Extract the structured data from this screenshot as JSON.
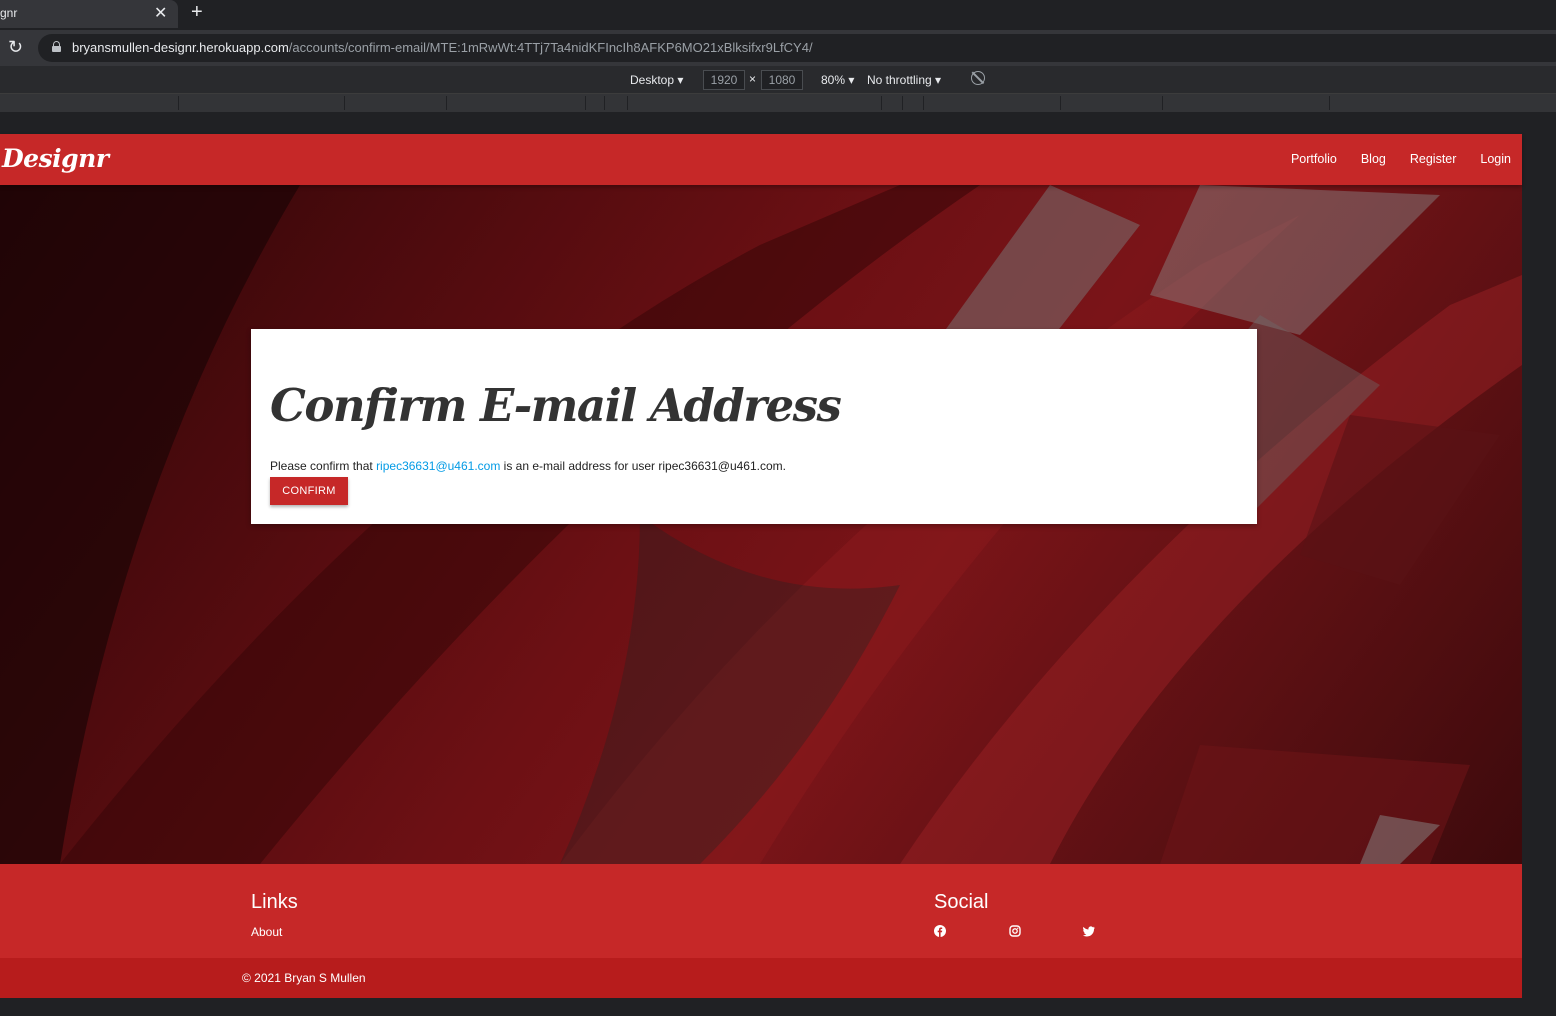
{
  "browser": {
    "tab_title": "gnr",
    "tab_close": "✕",
    "new_tab": "+",
    "reload": "↻",
    "url_host": "bryansmullen-designr.herokuapp.com",
    "url_path": "/accounts/confirm-email/MTE:1mRwWt:4TTj7Ta4nidKFIncIh8AFKP6MO21xBlksifxr9LfCY4/"
  },
  "devtools": {
    "device": "Desktop ▾",
    "width": "1920",
    "times": "×",
    "height": "1080",
    "zoom": "80% ▾",
    "throttling": "No throttling ▾"
  },
  "navbar": {
    "brand": "Designr",
    "links": [
      "Portfolio",
      "Blog",
      "Register",
      "Login"
    ]
  },
  "card": {
    "title": "Confirm E-mail Address",
    "text_before": "Please confirm that ",
    "email_link": "ripec36631@u461.com",
    "text_after": " is an e-mail address for user ripec36631@u461.com.",
    "confirm_button": "CONFIRM"
  },
  "footer": {
    "links_heading": "Links",
    "about": "About",
    "social_heading": "Social",
    "social_icons": [
      "facebook-icon",
      "instagram-icon",
      "twitter-icon"
    ],
    "copyright": "© 2021 Bryan S Mullen"
  },
  "colors": {
    "primary": "#c62828",
    "primary_dark": "#b71c1c",
    "link": "#039be5"
  }
}
